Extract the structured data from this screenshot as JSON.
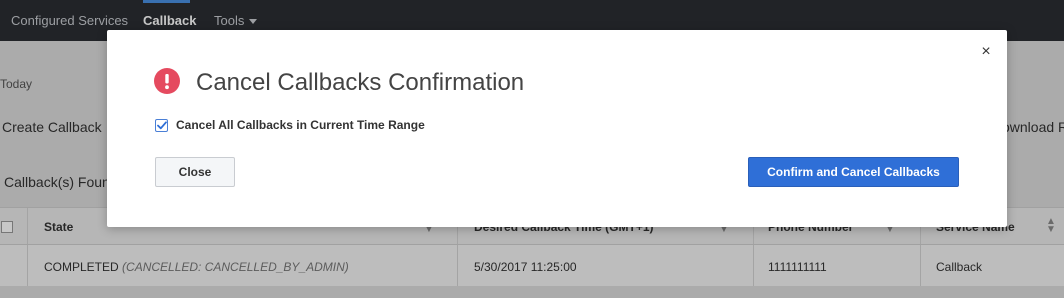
{
  "nav": {
    "items": [
      {
        "label": "Configured Services"
      },
      {
        "label": "Callback"
      },
      {
        "label": "Tools"
      }
    ]
  },
  "background": {
    "tab_today": "Today",
    "create_callback": "Create Callback",
    "download_report": "ownload Re",
    "callbacks_found": "Callback(s) Foun"
  },
  "table": {
    "headers": [
      "State",
      "Desired Callback Time (GMT+1)",
      "Phone Number",
      "Service Name"
    ],
    "rows": [
      {
        "state": "COMPLETED",
        "state_detail": "(CANCELLED: CANCELLED_BY_ADMIN)",
        "desired_time": "5/30/2017 11:25:00",
        "phone": "1111111111",
        "service": "Callback"
      }
    ]
  },
  "modal": {
    "title": "Cancel Callbacks Confirmation",
    "icon": "alert-circle-icon",
    "icon_color": "#e54a5f",
    "close_icon": "×",
    "checkbox_label": "Cancel All Callbacks in Current Time Range",
    "checkbox_checked": true,
    "close_button": "Close",
    "confirm_button": "Confirm and Cancel Callbacks",
    "accent_color": "#2f6fd7"
  }
}
